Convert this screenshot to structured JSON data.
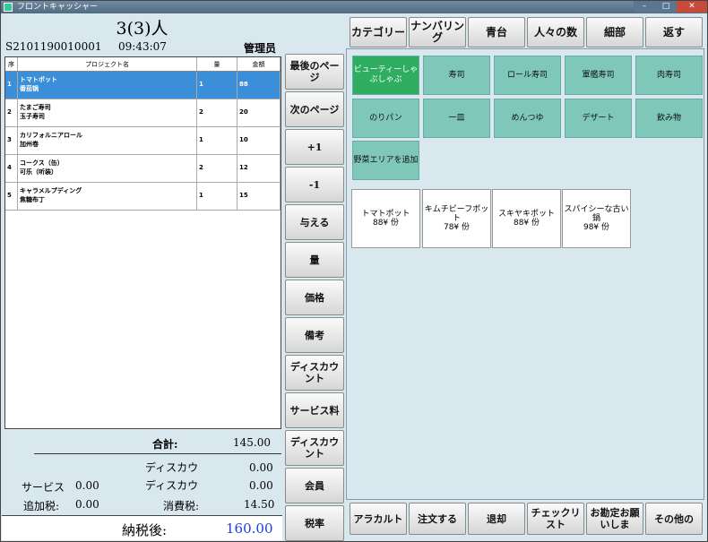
{
  "window": {
    "title": "フロントキャッシャー"
  },
  "header": {
    "person_count": "3(3)人",
    "order_no": "S2101190010001",
    "time": "09:43:07",
    "staff": "管理员"
  },
  "table": {
    "columns": [
      "序",
      "プロジェクト名",
      "量",
      "金額"
    ],
    "rows": [
      {
        "no": "1",
        "name1": "トマトポット",
        "name2": "番茄锅",
        "qty": "1",
        "amount": "88"
      },
      {
        "no": "2",
        "name1": "たまご寿司",
        "name2": "玉子寿司",
        "qty": "2",
        "amount": "20"
      },
      {
        "no": "3",
        "name1": "カリフォルニアロール",
        "name2": "加州卷",
        "qty": "1",
        "amount": "10"
      },
      {
        "no": "4",
        "name1": "コークス（缶）",
        "name2": "可乐（听装）",
        "qty": "2",
        "amount": "12"
      },
      {
        "no": "5",
        "name1": "キャラメルプディング",
        "name2": "焦糖布丁",
        "qty": "1",
        "amount": "15"
      }
    ]
  },
  "summary": {
    "total_label": "合計:",
    "total": "145.00",
    "discount_label1": "ディスカウ",
    "discount1": "0.00",
    "discount_label2": "ディスカウ",
    "discount2": "0.00",
    "service_label": "サービス",
    "service": "0.00",
    "tax_label": "消費税:",
    "tax": "14.50",
    "addtax_label": "追加税:",
    "addtax": "0.00",
    "aftertax_label": "納税後:",
    "aftertax": "160.00"
  },
  "mid_buttons": [
    "最後のページ",
    "次のページ",
    "+1",
    "-1",
    "与える",
    "量",
    "価格",
    "備考",
    "ディスカウント",
    "サービス料",
    "ディスカウント",
    "会員",
    "税率"
  ],
  "top_buttons": [
    "カテゴリー",
    "ナンバリング",
    "青台",
    "人々の数",
    "細部",
    "返す"
  ],
  "categories": [
    "ビューティーしゃぶしゃぶ",
    "寿司",
    "ロール寿司",
    "軍艦寿司",
    "肉寿司",
    "のりパン",
    "一皿",
    "めんつゆ",
    "デザート",
    "飲み物",
    "野菜エリアを追加"
  ],
  "items": [
    {
      "name": "トマトポット",
      "price": "88¥ 份"
    },
    {
      "name": "キムチビーフポット",
      "price": "78¥ 份"
    },
    {
      "name": "スキヤキポット",
      "price": "88¥ 份"
    },
    {
      "name": "スパイシーな古い鍋",
      "price": "98¥ 份"
    }
  ],
  "bottom_buttons": [
    "アラカルト",
    "注文する",
    "退却",
    "チェックリスト",
    "お勘定お願いしま",
    "その他の"
  ],
  "colors": {
    "accent_blue": "#3b8ed8",
    "category_green": "#7fc7b8",
    "active_green": "#2fae62",
    "total_blue": "#1a3fd6"
  }
}
